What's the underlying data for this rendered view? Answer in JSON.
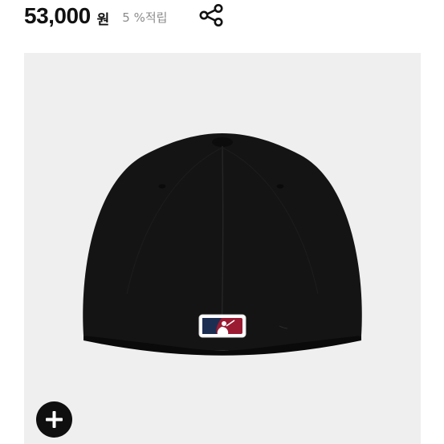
{
  "price": {
    "amount": "53,000",
    "unit": "원",
    "points": "5 %적립"
  },
  "icons": {
    "share": "share-icon",
    "expand": "plus-icon"
  },
  "colors": {
    "price_text": "#111111",
    "points_text": "#8c8c8c",
    "image_background": "#efefef",
    "cap": "#111111",
    "logo_red": "#9b1b33",
    "expand_button": "#0f0f0f"
  }
}
